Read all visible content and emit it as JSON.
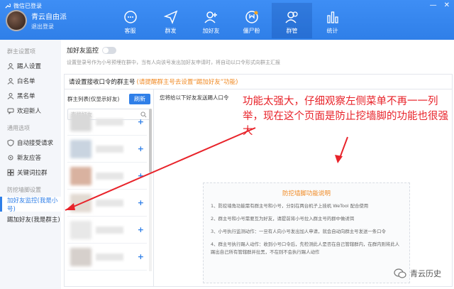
{
  "window": {
    "status": "微信已登录"
  },
  "profile": {
    "name": "青云自由派",
    "logout": "退出登录"
  },
  "nav": {
    "tabs": [
      {
        "label": "客服",
        "icon": "chat-bubble-icon",
        "active": false
      },
      {
        "label": "群发",
        "icon": "paper-plane-icon",
        "active": false
      },
      {
        "label": "加好友",
        "icon": "add-user-icon",
        "active": false
      },
      {
        "label": "僵尸粉",
        "icon": "zombie-fan-icon",
        "active": false
      },
      {
        "label": "群管",
        "icon": "group-icon",
        "active": true
      },
      {
        "label": "统计",
        "icon": "bar-stats-icon",
        "active": false
      }
    ]
  },
  "sidebar": {
    "group1": "群主设置项",
    "items1": [
      "踢人设置",
      "白名单",
      "黑名单",
      "欢迎新人"
    ],
    "group2": "通用选项",
    "items2": [
      "自动接受请求",
      "新友应答",
      "关键词拉群"
    ],
    "group3": "防挖墙脚设置",
    "items3": [
      "加好友监控(我是小号)",
      "踢加好友(我是群主)"
    ]
  },
  "main": {
    "switch_label": "加好友监控",
    "switch_on": false,
    "desc": "设置登录号作为小号预埋在群中，当有人向该号发出加好友申请时，将自动以口令形式向群主汇报",
    "panel_title": "请设置接收口令的群主号",
    "panel_hint": "(请提醒群主号去设置“踢加好友”功能)",
    "list_header": "群主列表(仅显示好友)",
    "refresh_label": "刷新",
    "search_placeholder": "查找好友",
    "right_header": "您将给以下好友发送踢人口令",
    "help": {
      "title": "防挖墙脚功能说明",
      "items": [
        "1、防挖墙角功能需有群主号和小号，分别在两台机子上挂机 WeTool 配合使用",
        "2、群主号和小号需要互为好友，请提前将小号拉入群主号的群中做诱饵",
        "3、小号执行监测动作：一旦有人向小号发出加人申请，就会自动向群主号发送一条口令",
        "4、群主号执行踢人动作：收到小号口令后，先检测此人是否在自己管辖群内，在群内则将此人踢出自己所有管辖群并拉黑，不在则不会执行踢人动作"
      ]
    }
  },
  "annotation": {
    "text": "功能太强大，仔细观察左侧菜单不再一一列举，现在这个页面是防止挖墙脚的功能也很强大"
  },
  "watermark": {
    "text": "青云历史"
  },
  "colors": {
    "brand": "#2f7fe8",
    "accent": "#f08a24",
    "note": "#e8232a"
  }
}
